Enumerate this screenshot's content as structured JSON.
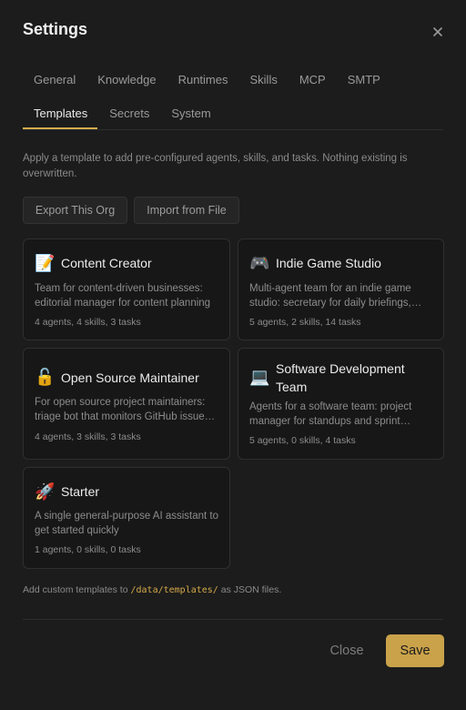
{
  "dialog": {
    "title": "Settings"
  },
  "tabs": {
    "row1": [
      {
        "label": "General"
      },
      {
        "label": "Knowledge"
      },
      {
        "label": "Runtimes"
      },
      {
        "label": "Skills"
      },
      {
        "label": "MCP"
      },
      {
        "label": "SMTP"
      }
    ],
    "row2": [
      {
        "label": "Templates",
        "active": true
      },
      {
        "label": "Secrets"
      },
      {
        "label": "System"
      }
    ]
  },
  "templates_page": {
    "description": "Apply a template to add pre-configured agents, skills, and tasks. Nothing existing is overwritten.",
    "export_label": "Export This Org",
    "import_label": "Import from File",
    "cards": [
      {
        "emoji": "📝",
        "name": "Content Creator",
        "text": "Team for content-driven businesses: editorial manager for content planning",
        "meta": "4 agents, 4 skills, 3 tasks"
      },
      {
        "emoji": "🎮",
        "name": "Indie Game Studio",
        "text": "Multi-agent team for an indie game studio: secretary for daily briefings, producer",
        "meta": "5 agents, 2 skills, 14 tasks"
      },
      {
        "emoji": "🔓",
        "name": "Open Source Maintainer",
        "text": "For open source project maintainers: triage bot that monitors GitHub issues and PRs",
        "meta": "4 agents, 3 skills, 3 tasks"
      },
      {
        "emoji": "💻",
        "name": "Software Development Team",
        "text": "Agents for a software team: project manager for standups and sprint planning",
        "meta": "5 agents, 0 skills, 4 tasks"
      },
      {
        "emoji": "🚀",
        "name": "Starter",
        "text": "A single general-purpose AI assistant to get started quickly",
        "meta": "1 agents, 0 skills, 0 tasks"
      }
    ],
    "footer_prefix": "Add custom templates to",
    "footer_path": "/data/templates/",
    "footer_suffix": "as JSON files."
  },
  "actions": {
    "close_label": "Close",
    "save_label": "Save"
  },
  "colors": {
    "accent": "#c9a24a",
    "background": "#1c1c1c",
    "card": "#171717"
  }
}
